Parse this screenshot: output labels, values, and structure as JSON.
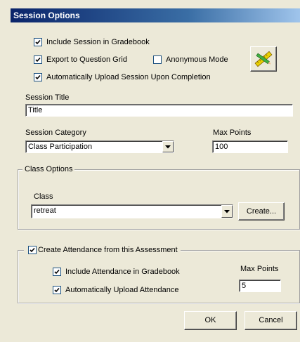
{
  "window": {
    "title": "Session Options"
  },
  "options": {
    "include_gradebook": {
      "label": "Include Session in Gradebook",
      "checked": true
    },
    "export_question_grid": {
      "label": "Export to Question Grid",
      "checked": true
    },
    "anonymous_mode": {
      "label": "Anonymous Mode",
      "checked": false
    },
    "auto_upload": {
      "label": "Automatically Upload Session Upon Completion",
      "checked": true
    }
  },
  "session_title": {
    "label": "Session Title",
    "value": "Title"
  },
  "session_category": {
    "label": "Session Category",
    "value": "Class Participation"
  },
  "max_points": {
    "label": "Max Points",
    "value": "100"
  },
  "class_options": {
    "legend": "Class Options",
    "class_label": "Class",
    "class_value": "retreat",
    "create_label": "Create..."
  },
  "attendance": {
    "create_label": "Create Attendance from this Assessment",
    "create_checked": true,
    "include_label": "Include Attendance in Gradebook",
    "include_checked": true,
    "upload_label": "Automatically Upload Attendance",
    "upload_checked": true,
    "max_points_label": "Max Points",
    "max_points_value": "5"
  },
  "buttons": {
    "ok": "OK",
    "cancel": "Cancel"
  },
  "icons": {
    "tool": "ruler-pencil-icon",
    "checkmark": "checkmark-icon",
    "dropdown": "chevron-down-icon"
  }
}
